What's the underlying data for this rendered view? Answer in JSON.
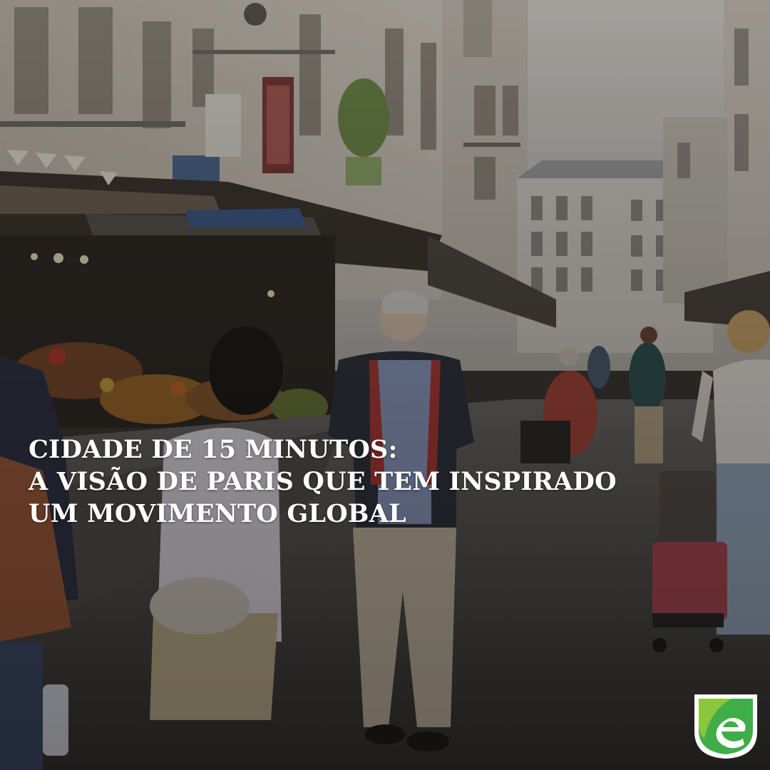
{
  "headline": {
    "line1": "CIDADE DE 15 MINUTOS:",
    "line2": "A VISÃO DE PARIS QUE TEM INSPIRADO",
    "line3": "UM MOVIMENTO GLOBAL"
  },
  "logo": {
    "icon": "e-leaf-logo-icon",
    "letter": "e",
    "colors": {
      "green": "#3fae49",
      "light_green": "#8cc63f",
      "white": "#ffffff"
    }
  },
  "photo": {
    "icon": "paris-street-market-photo",
    "colors": {
      "sky": "#c9c6c0",
      "building": "#b8b2a8",
      "street": "#4a4845",
      "overlay": "#1e1c1a"
    }
  }
}
